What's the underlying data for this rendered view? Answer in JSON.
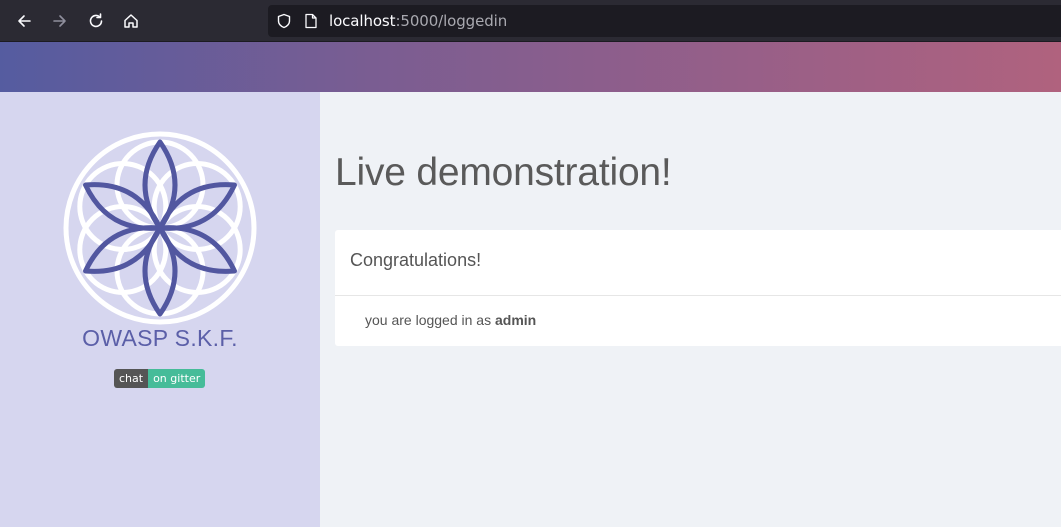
{
  "browser": {
    "url_host": "localhost",
    "url_rest": ":5000/loggedin"
  },
  "sidebar": {
    "brand": "OWASP S.K.F.",
    "badge_left": "chat",
    "badge_right": "on gitter"
  },
  "main": {
    "title": "Live demonstration!",
    "card_title": "Congratulations!",
    "card_text": "you are logged in as",
    "username": "admin"
  },
  "colors": {
    "accent": "#5b5fa8",
    "sidebar_bg": "#d6d6ef",
    "badge_green": "#46bc99"
  },
  "icons": {
    "back": "arrow-left-icon",
    "forward": "arrow-right-icon",
    "reload": "reload-icon",
    "home": "home-icon",
    "shield": "shield-icon",
    "page": "page-icon"
  }
}
